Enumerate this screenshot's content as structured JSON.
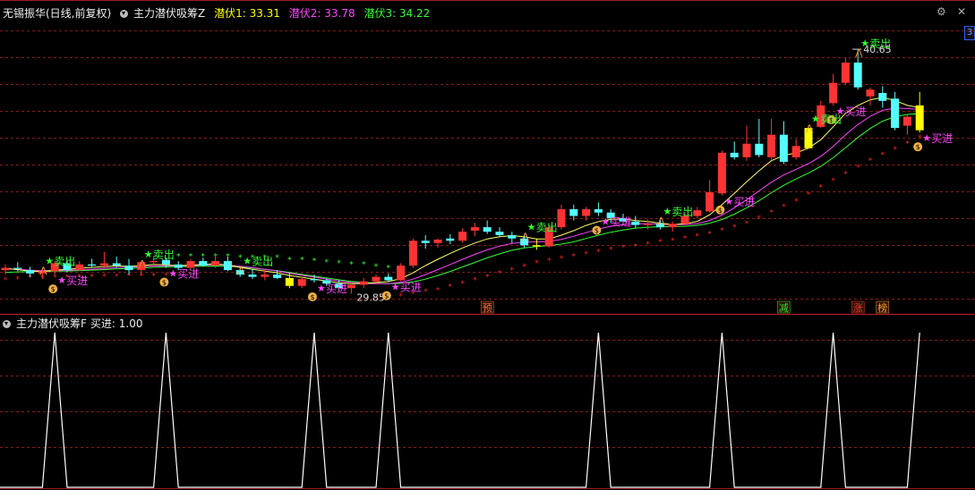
{
  "header": {
    "stock_name": "无锡振华(日线,前复权)",
    "indicator_name": "主力潜伏吸筹Z",
    "items": [
      {
        "label": "潜伏1: 33.31",
        "color": "#ffff00"
      },
      {
        "label": "潜伏2: 33.78",
        "color": "#ff00ff"
      },
      {
        "label": "潜伏3: 34.22",
        "color": "#00ff00"
      }
    ],
    "right_edge_label": "3"
  },
  "sub_header": {
    "indicator_name": "主力潜伏吸筹F",
    "value_label": "买进: 1.00"
  },
  "colors": {
    "up": "#ff3333",
    "down": "#54ffff",
    "yellow_body": "#ffff00",
    "ma1": "#ffff66",
    "ma2": "#ff44ff",
    "ma3": "#33ff33",
    "sar_up": "#ff2222",
    "sar_down": "#33ff33",
    "grid": "#8a1a1a",
    "buy": "#ff44ff",
    "sell": "#33ff33",
    "bottom_line": "#ffffff"
  },
  "chart_data": [
    {
      "type": "candlestick",
      "price_range": [
        29.0,
        42.0
      ],
      "high_label": "40.65",
      "low_label": "29.85",
      "candles": [
        [
          30.9,
          31.15,
          30.7,
          31.0
        ],
        [
          31.0,
          31.25,
          30.85,
          30.95
        ],
        [
          30.9,
          31.05,
          30.6,
          30.75
        ],
        [
          30.75,
          31.0,
          30.5,
          30.85
        ],
        [
          30.85,
          31.3,
          30.7,
          31.2
        ],
        [
          31.2,
          31.35,
          30.8,
          30.9
        ],
        [
          30.9,
          31.3,
          30.85,
          31.15
        ],
        [
          31.15,
          31.4,
          31.0,
          31.1
        ],
        [
          31.1,
          31.7,
          31.0,
          31.2
        ],
        [
          31.2,
          31.5,
          31.0,
          31.1
        ],
        [
          31.1,
          31.4,
          30.7,
          30.9
        ],
        [
          30.9,
          31.3,
          30.7,
          31.25
        ],
        [
          31.25,
          31.5,
          31.0,
          31.3
        ],
        [
          31.35,
          31.45,
          31.0,
          31.15
        ],
        [
          31.15,
          31.3,
          30.9,
          31.0
        ],
        [
          31.0,
          31.4,
          30.95,
          31.3
        ],
        [
          31.3,
          31.45,
          31.05,
          31.1
        ],
        [
          31.1,
          31.6,
          31.0,
          31.3
        ],
        [
          31.3,
          31.5,
          30.85,
          30.9
        ],
        [
          30.9,
          31.0,
          30.6,
          30.7
        ],
        [
          30.7,
          30.95,
          30.5,
          30.6
        ],
        [
          30.6,
          30.9,
          30.45,
          30.7
        ],
        [
          30.7,
          30.9,
          30.5,
          30.55
        ],
        [
          30.55,
          30.8,
          30.1,
          30.2
        ],
        [
          30.2,
          30.6,
          30.1,
          30.5
        ],
        [
          30.5,
          30.7,
          30.35,
          30.45
        ],
        [
          30.45,
          30.55,
          30.2,
          30.3
        ],
        [
          30.3,
          30.45,
          30.0,
          30.1
        ],
        [
          30.1,
          30.35,
          29.85,
          30.25
        ],
        [
          30.25,
          30.55,
          30.1,
          30.4
        ],
        [
          30.4,
          30.7,
          30.3,
          30.6
        ],
        [
          30.6,
          30.75,
          30.4,
          30.45
        ],
        [
          30.45,
          31.2,
          30.4,
          31.1
        ],
        [
          31.1,
          32.3,
          31.0,
          32.2
        ],
        [
          32.2,
          32.45,
          31.85,
          32.1
        ],
        [
          32.1,
          32.3,
          31.9,
          32.25
        ],
        [
          32.3,
          32.5,
          32.05,
          32.2
        ],
        [
          32.2,
          32.75,
          32.1,
          32.6
        ],
        [
          32.65,
          33.0,
          32.4,
          32.8
        ],
        [
          32.8,
          33.1,
          32.5,
          32.6
        ],
        [
          32.6,
          32.8,
          32.35,
          32.45
        ],
        [
          32.45,
          32.6,
          32.1,
          32.3
        ],
        [
          32.3,
          32.5,
          31.9,
          32.0
        ],
        [
          32.0,
          32.3,
          31.8,
          31.95
        ],
        [
          31.95,
          32.9,
          31.9,
          32.8
        ],
        [
          32.8,
          33.8,
          32.7,
          33.6
        ],
        [
          33.6,
          33.8,
          33.1,
          33.3
        ],
        [
          33.3,
          33.7,
          33.1,
          33.6
        ],
        [
          33.6,
          33.9,
          33.3,
          33.45
        ],
        [
          33.45,
          33.6,
          33.0,
          33.2
        ],
        [
          33.2,
          33.4,
          32.9,
          33.05
        ],
        [
          33.05,
          33.3,
          32.75,
          32.9
        ],
        [
          32.9,
          33.15,
          32.7,
          32.95
        ],
        [
          32.95,
          33.2,
          32.7,
          32.8
        ],
        [
          32.8,
          33.05,
          32.6,
          32.95
        ],
        [
          32.95,
          33.4,
          32.9,
          33.3
        ],
        [
          33.3,
          33.7,
          33.2,
          33.55
        ],
        [
          33.5,
          34.9,
          33.45,
          34.35
        ],
        [
          34.3,
          36.2,
          34.2,
          36.1
        ],
        [
          36.1,
          36.6,
          35.8,
          35.9
        ],
        [
          35.9,
          37.3,
          35.75,
          36.5
        ],
        [
          36.5,
          37.6,
          35.9,
          36.0
        ],
        [
          35.9,
          37.6,
          35.8,
          36.9
        ],
        [
          36.9,
          37.5,
          35.6,
          35.7
        ],
        [
          35.9,
          36.7,
          35.8,
          36.4
        ],
        [
          36.3,
          37.3,
          36.3,
          37.2
        ],
        [
          37.25,
          38.4,
          37.2,
          38.2
        ],
        [
          38.3,
          39.6,
          38.2,
          39.2
        ],
        [
          39.2,
          40.3,
          39.1,
          40.1
        ],
        [
          40.1,
          40.65,
          38.9,
          39.0
        ],
        [
          38.6,
          39.0,
          38.2,
          38.9
        ],
        [
          38.75,
          39.05,
          38.1,
          38.4
        ],
        [
          38.5,
          38.8,
          37.1,
          37.2
        ],
        [
          37.3,
          37.8,
          36.9,
          37.7
        ],
        [
          37.1,
          38.8,
          37.0,
          38.2
        ]
      ],
      "ma1": [
        30.98,
        30.92,
        30.86,
        30.84,
        30.9,
        30.93,
        30.98,
        31.02,
        31.05,
        31.09,
        31.06,
        31.1,
        31.15,
        31.13,
        31.1,
        31.12,
        31.15,
        31.18,
        31.12,
        31.02,
        30.93,
        30.86,
        30.78,
        30.66,
        30.58,
        30.5,
        30.42,
        30.33,
        30.3,
        30.3,
        30.35,
        30.39,
        30.52,
        30.78,
        31.1,
        31.38,
        31.64,
        31.88,
        32.1,
        32.28,
        32.38,
        32.43,
        32.38,
        32.28,
        32.28,
        32.45,
        32.65,
        32.88,
        33.05,
        33.15,
        33.16,
        33.1,
        33.05,
        32.98,
        32.92,
        32.95,
        33.06,
        33.35,
        33.8,
        34.3,
        34.82,
        35.3,
        35.75,
        35.98,
        36.1,
        36.3,
        36.68,
        37.25,
        37.85,
        38.2,
        38.45,
        38.55,
        38.42,
        38.2,
        38.1
      ],
      "ma2": [
        30.95,
        30.93,
        30.9,
        30.87,
        30.88,
        30.89,
        30.91,
        30.94,
        30.97,
        31.01,
        31.02,
        31.05,
        31.08,
        31.09,
        31.09,
        31.1,
        31.12,
        31.14,
        31.12,
        31.07,
        31.01,
        30.94,
        30.86,
        30.76,
        30.67,
        30.59,
        30.5,
        30.41,
        30.35,
        30.31,
        30.3,
        30.3,
        30.36,
        30.5,
        30.7,
        30.92,
        31.15,
        31.38,
        31.6,
        31.8,
        31.96,
        32.08,
        32.14,
        32.15,
        32.17,
        32.26,
        32.4,
        32.56,
        32.72,
        32.84,
        32.92,
        32.95,
        32.96,
        32.94,
        32.92,
        32.92,
        32.96,
        33.1,
        33.34,
        33.66,
        34.02,
        34.41,
        34.8,
        35.12,
        35.37,
        35.62,
        35.94,
        36.38,
        36.9,
        37.35,
        37.72,
        37.98,
        38.08,
        38.06,
        38.02
      ],
      "ma3": [
        30.8,
        30.82,
        30.83,
        30.84,
        30.85,
        30.86,
        30.88,
        30.9,
        30.92,
        30.95,
        30.97,
        31.0,
        31.02,
        31.04,
        31.05,
        31.06,
        31.07,
        31.08,
        31.07,
        31.04,
        30.99,
        30.93,
        30.87,
        30.79,
        30.71,
        30.63,
        30.55,
        30.47,
        30.4,
        30.35,
        30.32,
        30.3,
        30.31,
        30.38,
        30.5,
        30.66,
        30.84,
        31.04,
        31.24,
        31.44,
        31.62,
        31.78,
        31.88,
        31.94,
        31.98,
        32.05,
        32.15,
        32.3,
        32.45,
        32.58,
        32.68,
        32.76,
        32.8,
        32.82,
        32.83,
        32.84,
        32.88,
        32.98,
        33.14,
        33.38,
        33.66,
        33.98,
        34.33,
        34.66,
        34.94,
        35.2,
        35.5,
        35.88,
        36.33,
        36.78,
        37.18,
        37.5,
        37.7,
        37.8,
        37.84
      ],
      "sar": [
        {
          "dir": "up",
          "v": [
            30.5,
            30.55,
            30.6,
            30.6,
            30.62,
            30.63,
            30.64,
            30.65,
            30.66,
            30.67,
            30.68,
            30.68,
            30.69,
            30.7
          ]
        },
        {
          "dir": "down",
          "v": [
            31.55,
            31.55,
            31.55,
            31.55,
            31.55,
            31.5,
            31.5,
            31.5,
            31.5,
            31.4,
            31.4,
            31.35,
            31.3,
            31.25,
            31.2,
            31.2,
            31.1,
            31.05
          ]
        },
        {
          "dir": "up",
          "v": [
            29.8,
            29.9,
            30.0,
            30.05,
            30.2,
            30.35,
            30.5,
            30.65,
            30.8,
            30.95,
            31.1,
            31.25,
            31.35,
            31.45,
            31.55,
            31.65,
            31.75,
            31.85,
            31.95,
            32.0,
            32.1,
            32.2,
            32.25,
            32.35,
            32.45,
            32.55,
            32.7,
            32.85,
            33.0,
            33.25,
            33.5,
            33.75,
            34.0,
            34.3,
            34.6,
            34.9,
            35.2,
            35.5,
            35.8,
            36.05,
            36.3,
            36.55,
            36.8
          ]
        }
      ],
      "buy_signals": [
        {
          "i": 4,
          "label": "买进"
        },
        {
          "i": 13,
          "label": "买进"
        },
        {
          "i": 25,
          "label": "买进"
        },
        {
          "i": 31,
          "label": "买进"
        },
        {
          "i": 48,
          "label": "买进"
        },
        {
          "i": 58,
          "label": "买进"
        },
        {
          "i": 67,
          "label": "买进"
        },
        {
          "i": 74,
          "label": "买进"
        }
      ],
      "sell_signals": [
        {
          "i": 3,
          "label": "卖出"
        },
        {
          "i": 11,
          "label": "卖出"
        },
        {
          "i": 19,
          "label": "卖出"
        },
        {
          "i": 42,
          "label": "卖出"
        },
        {
          "i": 53,
          "label": "卖出"
        },
        {
          "i": 65,
          "label": "卖出"
        },
        {
          "i": 69,
          "label": "卖出"
        }
      ],
      "event_markers": [
        {
          "i": 39,
          "label": "预",
          "color": "#ff6633"
        },
        {
          "i": 63,
          "label": "减",
          "color": "#33dd33"
        },
        {
          "i": 69,
          "label": "涨",
          "color": "#ff3333"
        },
        {
          "i": 71,
          "label": "榜",
          "color": "#ff9933"
        }
      ]
    },
    {
      "type": "line",
      "series": [
        {
          "name": "买进",
          "peak_indices": [
            4,
            13,
            25,
            31,
            48,
            58,
            67,
            74
          ],
          "peak_value": 1,
          "base_value": 0
        }
      ]
    }
  ]
}
